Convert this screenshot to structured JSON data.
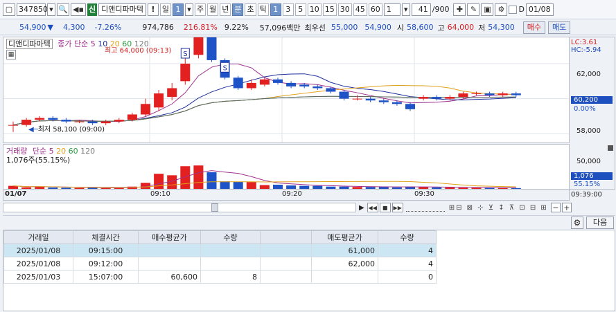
{
  "toolbar": {
    "code": "347850",
    "shin_badge": "신",
    "stock_name": "디앤디파마텍",
    "excl": "!",
    "period_il": "일",
    "period_num": "1",
    "periods": [
      "주",
      "월",
      "년"
    ],
    "bun_label": "分",
    "cho_label": "초",
    "tick_label": "틱",
    "intervals": [
      "1",
      "3",
      "5",
      "10",
      "15",
      "30",
      "45",
      "60"
    ],
    "interval_value": "1",
    "page_counter": "41",
    "page_total": "/900",
    "d_label": "D",
    "date_value": "01/08"
  },
  "quote": {
    "price": "54,900",
    "arrow": "▼",
    "change": "4,300",
    "change_pct": "-7.26%",
    "volume": "974,786",
    "vol_ratio": "216.81%",
    "turnover_pct": "9.22%",
    "amount": "57,096백만",
    "best_label": "최우선",
    "best_ask": "55,000",
    "best_bid": "54,900",
    "open_label": "시",
    "open": "58,600",
    "high_label": "고",
    "high": "64,000",
    "low_label": "저",
    "low": "54,300",
    "buy_button": "매수",
    "sell_button": "매도"
  },
  "price_chart": {
    "name_label": "디앤디파마텍",
    "ma_label": "종가 단순",
    "ma_periods": [
      "5",
      "10",
      "20",
      "60",
      "120"
    ],
    "high_annotation": "최고 64,000 (09:13)",
    "low_annotation": "최저 58,100 (09:00)",
    "lc_label": "LC:3.61",
    "hc_label": "HC:-5.94",
    "axis_labels": [
      "62,000",
      "60,000",
      "58,000"
    ],
    "current_price": "60,200",
    "current_pct": "0.00%",
    "signal_marker": "S"
  },
  "volume_chart": {
    "title": "거래량",
    "ma_label": "단순",
    "ma_periods": [
      "5",
      "20",
      "60",
      "120"
    ],
    "current_text": "1,076주(55.15%)",
    "axis_label": "50,000",
    "current_value": "1,076",
    "current_pct": "55.15%"
  },
  "time_axis": {
    "date": "01/07",
    "ticks": [
      "09:10",
      "09:20",
      "09:30"
    ],
    "end_time": "09:39:00"
  },
  "chart_data": [
    {
      "type": "candlestick",
      "x": [
        "09:00",
        "09:01",
        "09:02",
        "09:03",
        "09:04",
        "09:05",
        "09:06",
        "09:07",
        "09:08",
        "09:09",
        "09:10",
        "09:11",
        "09:12",
        "09:13",
        "09:14",
        "09:15",
        "09:16",
        "09:17",
        "09:18",
        "09:19",
        "09:20",
        "09:21",
        "09:22",
        "09:23",
        "09:24",
        "09:25",
        "09:26",
        "09:27",
        "09:28",
        "09:29",
        "09:30",
        "09:31",
        "09:32",
        "09:33",
        "09:34",
        "09:35",
        "09:36",
        "09:37",
        "09:38"
      ],
      "open": [
        58500,
        58500,
        58800,
        58900,
        58800,
        58700,
        58700,
        58600,
        58700,
        58800,
        59100,
        59500,
        60100,
        61000,
        62500,
        63800,
        62200,
        61200,
        60600,
        60800,
        61100,
        60900,
        60800,
        60700,
        60600,
        60400,
        60000,
        60000,
        59900,
        59800,
        59700,
        60000,
        60100,
        60000,
        60100,
        60300,
        60300,
        60200,
        60300
      ],
      "close": [
        58500,
        58800,
        58900,
        58800,
        58700,
        58700,
        58600,
        58700,
        58800,
        59100,
        59700,
        60300,
        60600,
        62000,
        63900,
        62200,
        61200,
        60600,
        60900,
        61100,
        60900,
        60700,
        60700,
        60600,
        60400,
        60000,
        60000,
        59900,
        59800,
        59700,
        59400,
        60100,
        60000,
        60100,
        60300,
        60300,
        60200,
        60300,
        60200
      ],
      "high": [
        58700,
        58900,
        59000,
        59000,
        58900,
        58800,
        58800,
        58800,
        58900,
        59200,
        60000,
        60500,
        60900,
        62300,
        64000,
        63900,
        62300,
        61300,
        61100,
        61200,
        61200,
        61000,
        60900,
        60800,
        60700,
        60500,
        60200,
        60100,
        60000,
        59900,
        59800,
        60200,
        60200,
        60200,
        60400,
        60400,
        60400,
        60400,
        60400
      ],
      "low": [
        58100,
        58400,
        58700,
        58700,
        58600,
        58600,
        58500,
        58500,
        58600,
        58700,
        59000,
        59300,
        59900,
        60800,
        62300,
        62100,
        61100,
        60500,
        60500,
        60700,
        60800,
        60600,
        60600,
        60500,
        60300,
        59900,
        59900,
        59800,
        59700,
        59600,
        59300,
        59900,
        59900,
        59900,
        60000,
        60200,
        60100,
        60100,
        60100
      ],
      "ylim": [
        57500,
        63500
      ]
    },
    {
      "type": "bar",
      "name": "거래량",
      "x": [
        "09:00",
        "09:01",
        "09:02",
        "09:03",
        "09:04",
        "09:05",
        "09:06",
        "09:07",
        "09:08",
        "09:09",
        "09:10",
        "09:11",
        "09:12",
        "09:13",
        "09:14",
        "09:15",
        "09:16",
        "09:17",
        "09:18",
        "09:19",
        "09:20",
        "09:21",
        "09:22",
        "09:23",
        "09:24",
        "09:25",
        "09:26",
        "09:27",
        "09:28",
        "09:29",
        "09:30",
        "09:31",
        "09:32",
        "09:33",
        "09:34",
        "09:35",
        "09:36",
        "09:37",
        "09:38"
      ],
      "values": [
        4000,
        2000,
        3000,
        1800,
        1500,
        1200,
        1500,
        1000,
        1500,
        3000,
        8000,
        20000,
        18000,
        30000,
        31000,
        22000,
        10000,
        9500,
        9000,
        5000,
        5500,
        4500,
        4000,
        4000,
        3000,
        3000,
        2500,
        2500,
        3000,
        2000,
        3000,
        2500,
        2000,
        1800,
        1500,
        1500,
        1500,
        1200,
        1076
      ],
      "ylim": [
        0,
        55000
      ]
    }
  ],
  "trades": {
    "headers": [
      "거래일",
      "체결시간",
      "매수평균가",
      "수량",
      "",
      "매도평균가",
      "수량"
    ],
    "rows": [
      [
        "2025/01/08",
        "09:15:00",
        "",
        "",
        "",
        "61,000",
        "4"
      ],
      [
        "2025/01/08",
        "09:12:00",
        "",
        "",
        "",
        "62,000",
        "4"
      ],
      [
        "2025/01/03",
        "15:07:00",
        "60,600",
        "8",
        "",
        "",
        "0"
      ]
    ],
    "next_button": "다음"
  }
}
